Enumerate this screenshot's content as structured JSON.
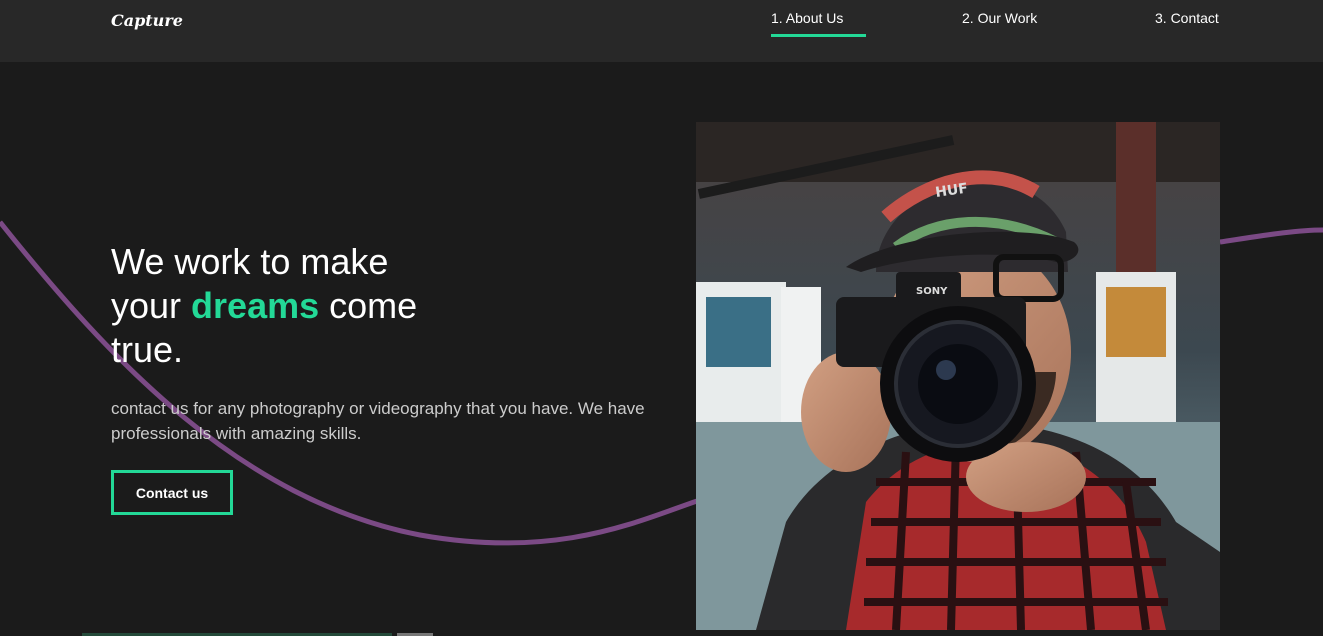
{
  "nav": {
    "logo": "Capture",
    "links": [
      {
        "label": "1. About Us",
        "active": true
      },
      {
        "label": "2. Our Work"
      },
      {
        "label": "3. Contact"
      }
    ]
  },
  "hero": {
    "headline_line1": "We work to make",
    "headline_your": "your",
    "headline_accent": "dreams",
    "headline_come": "come",
    "headline_line3": "true.",
    "description": "contact us for any photography or videography that you have. We have professionals with amazing skills.",
    "button_label": "Contact us",
    "image_label": "HUF",
    "camera_brand": "SONY"
  },
  "colors": {
    "accent": "#23d997",
    "background": "#1b1b1b",
    "nav_background": "#282828",
    "wave": "#7b4a85"
  }
}
